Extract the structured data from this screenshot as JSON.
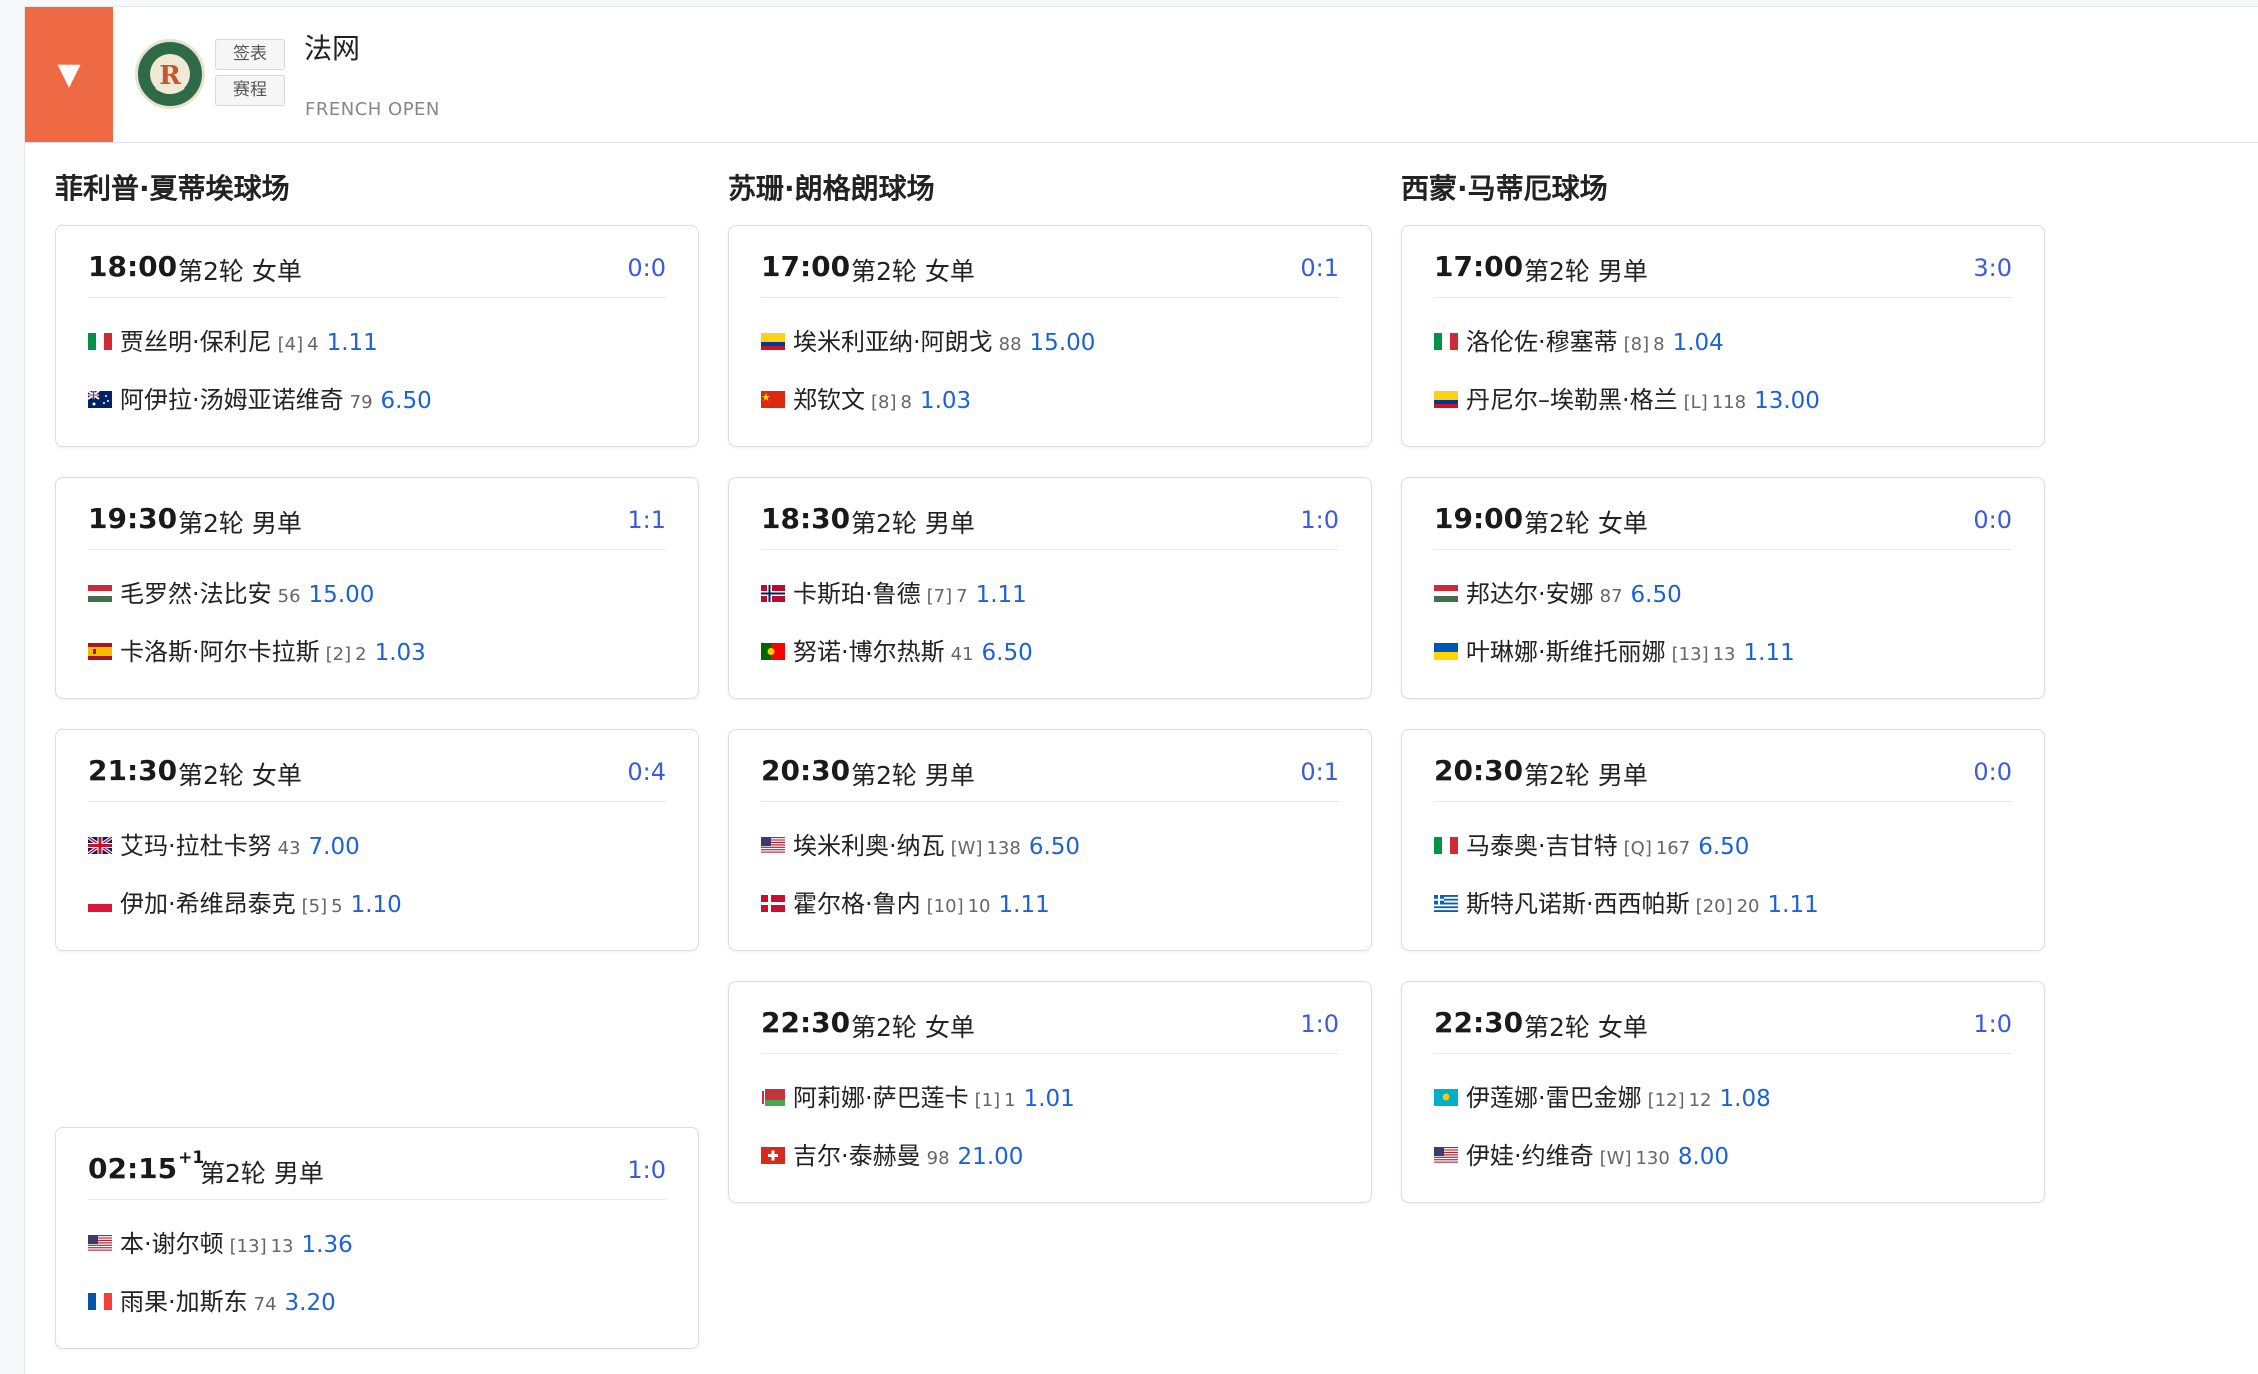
{
  "header": {
    "collapse_icon": "▼",
    "title": "法网",
    "subtitle": "FRENCH OPEN",
    "btn_draw": "签表",
    "btn_schedule": "赛程",
    "logo_text": "ROLAND GARROS"
  },
  "colors": {
    "accent": "#ee6a45",
    "score": "#3b5bdb",
    "odds": "#1c62d6"
  },
  "courts": [
    {
      "name": "菲利普·夏蒂埃球场",
      "matches": [
        {
          "time": "18:00",
          "sup": "",
          "round": "第2轮",
          "type": "女单",
          "score": "0:0",
          "p1": {
            "flag": "it",
            "name": "贾丝明·保利尼",
            "seed": "[4]",
            "rank": "4",
            "odds": "1.11"
          },
          "p2": {
            "flag": "au",
            "name": "阿伊拉·汤姆亚诺维奇",
            "seed": "",
            "rank": "79",
            "odds": "6.50"
          }
        },
        {
          "time": "19:30",
          "sup": "",
          "round": "第2轮",
          "type": "男单",
          "score": "1:1",
          "p1": {
            "flag": "hu",
            "name": "毛罗然·法比安",
            "seed": "",
            "rank": "56",
            "odds": "15.00"
          },
          "p2": {
            "flag": "es",
            "name": "卡洛斯·阿尔卡拉斯",
            "seed": "[2]",
            "rank": "2",
            "odds": "1.03"
          }
        },
        {
          "time": "21:30",
          "sup": "",
          "round": "第2轮",
          "type": "女单",
          "score": "0:4",
          "p1": {
            "flag": "gb",
            "name": "艾玛·拉杜卡努",
            "seed": "",
            "rank": "43",
            "odds": "7.00"
          },
          "p2": {
            "flag": "pl",
            "name": "伊加·希维昂泰克",
            "seed": "[5]",
            "rank": "5",
            "odds": "1.10"
          }
        },
        {
          "time": "02:15",
          "sup": "+1",
          "round": "第2轮",
          "type": "男单",
          "score": "1:0",
          "p1": {
            "flag": "us",
            "name": "本·谢尔顿",
            "seed": "[13]",
            "rank": "13",
            "odds": "1.36"
          },
          "p2": {
            "flag": "fr",
            "name": "雨果·加斯东",
            "seed": "",
            "rank": "74",
            "odds": "3.20"
          }
        }
      ]
    },
    {
      "name": "苏珊·朗格朗球场",
      "matches": [
        {
          "time": "17:00",
          "sup": "",
          "round": "第2轮",
          "type": "女单",
          "score": "0:1",
          "p1": {
            "flag": "co",
            "name": "埃米利亚纳·阿朗戈",
            "seed": "",
            "rank": "88",
            "odds": "15.00"
          },
          "p2": {
            "flag": "cn",
            "name": "郑钦文",
            "seed": "[8]",
            "rank": "8",
            "odds": "1.03"
          }
        },
        {
          "time": "18:30",
          "sup": "",
          "round": "第2轮",
          "type": "男单",
          "score": "1:0",
          "p1": {
            "flag": "no",
            "name": "卡斯珀·鲁德",
            "seed": "[7]",
            "rank": "7",
            "odds": "1.11"
          },
          "p2": {
            "flag": "pt",
            "name": "努诺·博尔热斯",
            "seed": "",
            "rank": "41",
            "odds": "6.50"
          }
        },
        {
          "time": "20:30",
          "sup": "",
          "round": "第2轮",
          "type": "男单",
          "score": "0:1",
          "p1": {
            "flag": "us",
            "name": "埃米利奥·纳瓦",
            "seed": "[W]",
            "rank": "138",
            "odds": "6.50"
          },
          "p2": {
            "flag": "dk",
            "name": "霍尔格·鲁内",
            "seed": "[10]",
            "rank": "10",
            "odds": "1.11"
          }
        },
        {
          "time": "22:30",
          "sup": "",
          "round": "第2轮",
          "type": "女单",
          "score": "1:0",
          "p1": {
            "flag": "by",
            "name": "阿莉娜·萨巴莲卡",
            "seed": "[1]",
            "rank": "1",
            "odds": "1.01"
          },
          "p2": {
            "flag": "ch",
            "name": "吉尔·泰赫曼",
            "seed": "",
            "rank": "98",
            "odds": "21.00"
          }
        }
      ]
    },
    {
      "name": "西蒙·马蒂厄球场",
      "matches": [
        {
          "time": "17:00",
          "sup": "",
          "round": "第2轮",
          "type": "男单",
          "score": "3:0",
          "p1": {
            "flag": "it",
            "name": "洛伦佐·穆塞蒂",
            "seed": "[8]",
            "rank": "8",
            "odds": "1.04"
          },
          "p2": {
            "flag": "co",
            "name": "丹尼尔–埃勒黑·格兰",
            "seed": "[L]",
            "rank": "118",
            "odds": "13.00"
          }
        },
        {
          "time": "19:00",
          "sup": "",
          "round": "第2轮",
          "type": "女单",
          "score": "0:0",
          "p1": {
            "flag": "hu",
            "name": "邦达尔·安娜",
            "seed": "",
            "rank": "87",
            "odds": "6.50"
          },
          "p2": {
            "flag": "ua",
            "name": "叶琳娜·斯维托丽娜",
            "seed": "[13]",
            "rank": "13",
            "odds": "1.11"
          }
        },
        {
          "time": "20:30",
          "sup": "",
          "round": "第2轮",
          "type": "男单",
          "score": "0:0",
          "p1": {
            "flag": "it",
            "name": "马泰奥·吉甘特",
            "seed": "[Q]",
            "rank": "167",
            "odds": "6.50"
          },
          "p2": {
            "flag": "gr",
            "name": "斯特凡诺斯·西西帕斯",
            "seed": "[20]",
            "rank": "20",
            "odds": "1.11"
          }
        },
        {
          "time": "22:30",
          "sup": "",
          "round": "第2轮",
          "type": "女单",
          "score": "1:0",
          "p1": {
            "flag": "kz",
            "name": "伊莲娜·雷巴金娜",
            "seed": "[12]",
            "rank": "12",
            "odds": "1.08"
          },
          "p2": {
            "flag": "us",
            "name": "伊娃·约维奇",
            "seed": "[W]",
            "rank": "130",
            "odds": "8.00"
          }
        }
      ]
    }
  ]
}
